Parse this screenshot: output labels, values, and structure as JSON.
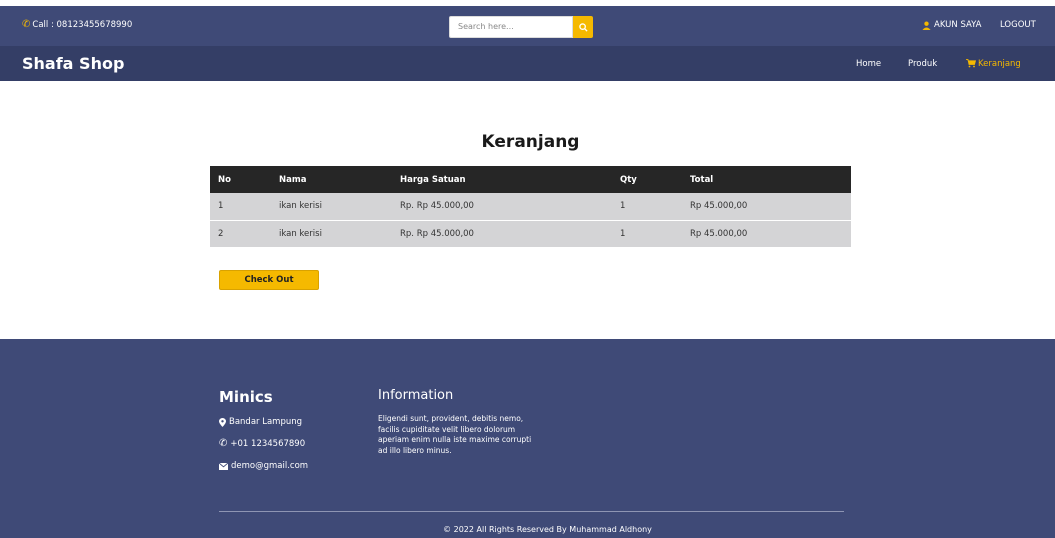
{
  "topbar": {
    "call": "Call : 08123455678990",
    "search_placeholder": "Search here...",
    "account": "AKUN SAYA",
    "logout": "LOGOUT"
  },
  "navbar": {
    "brand": "Shafa Shop",
    "items": [
      {
        "label": "Home"
      },
      {
        "label": "Produk"
      },
      {
        "label": "Keranjang",
        "active": true
      }
    ]
  },
  "main": {
    "title": "Keranjang",
    "table": {
      "headers": [
        "No",
        "Nama",
        "Harga Satuan",
        "Qty",
        "Total"
      ],
      "rows": [
        [
          "1",
          "ikan kerisi",
          "Rp. Rp 45.000,00",
          "1",
          "Rp 45.000,00"
        ],
        [
          "2",
          "ikan kerisi",
          "Rp. Rp 45.000,00",
          "1",
          "Rp 45.000,00"
        ]
      ]
    },
    "checkout_label": "Check Out"
  },
  "footer": {
    "title": "Minics",
    "location": "Bandar Lampung",
    "phone": "+01 1234567890",
    "email": "demo@gmail.com",
    "info_title": "Information",
    "info_text": "Eligendi sunt, provident, debitis nemo, facilis cupiditate velit libero dolorum aperiam enim nulla iste maxime corrupti ad illo libero minus.",
    "copyright": "© 2022 All Rights Reserved By Muhammad Aldhony"
  },
  "colors": {
    "topbar": "#3f4a77",
    "navbar": "#343e66",
    "accent": "#f5b900",
    "table_header": "#262626"
  }
}
